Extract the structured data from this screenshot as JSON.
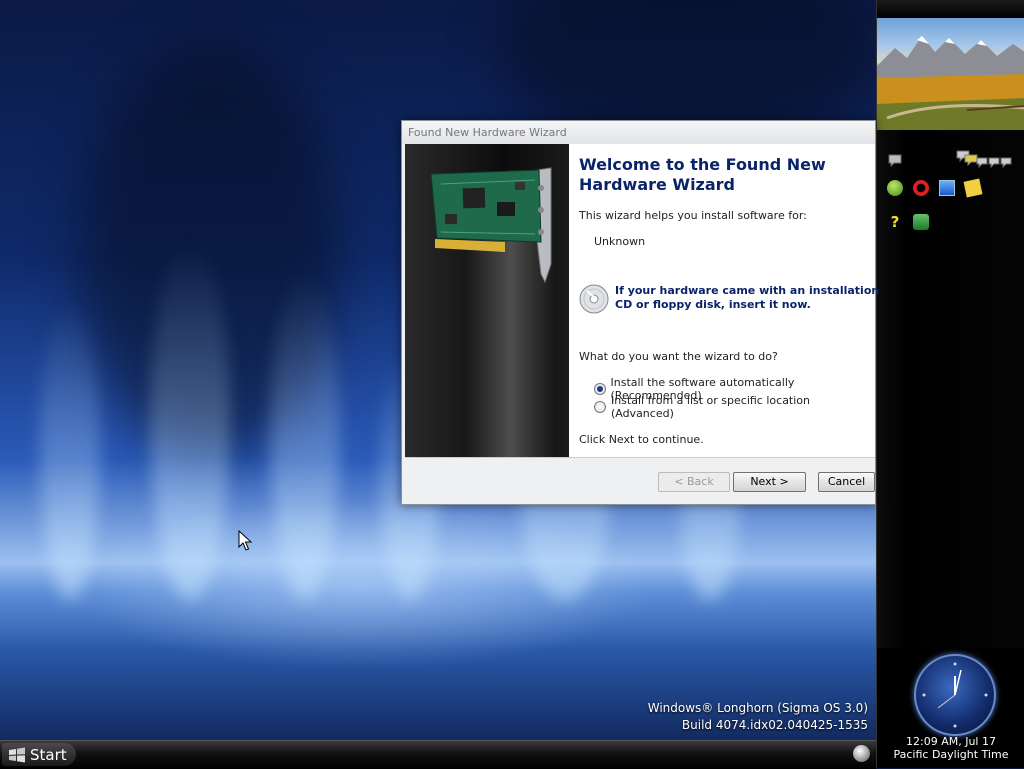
{
  "wizard": {
    "title": "Found New Hardware Wizard",
    "heading": "Welcome to the Found New Hardware Wizard",
    "intro": "This wizard helps you install software for:",
    "device": "Unknown",
    "cd_prompt": "If your hardware came with an installation CD or floppy disk, insert it now.",
    "question": "What do you want the wizard to do?",
    "options": [
      {
        "label": "Install the software automatically (Recommended)",
        "selected": true
      },
      {
        "label": "Install from a list or specific location (Advanced)",
        "selected": false
      }
    ],
    "continue_hint": "Click Next to continue.",
    "buttons": {
      "back": "< Back",
      "next": "Next >",
      "cancel": "Cancel"
    }
  },
  "desktop": {
    "watermark_line1": "Windows® Longhorn (Sigma OS 3.0)",
    "watermark_line2": "Build 4074.idx02.040425-1535"
  },
  "taskbar": {
    "start_label": "Start"
  },
  "sidebar": {
    "clock_time": "12:09 AM, Jul 17",
    "clock_zone": "Pacific Daylight Time",
    "tile_icons": [
      "chat-bubble-icon",
      "group-chat-icon",
      "green-globe-icon",
      "opera-icon",
      "monitor-icon",
      "notes-icon",
      "help-icon",
      "security-check-icon"
    ]
  }
}
